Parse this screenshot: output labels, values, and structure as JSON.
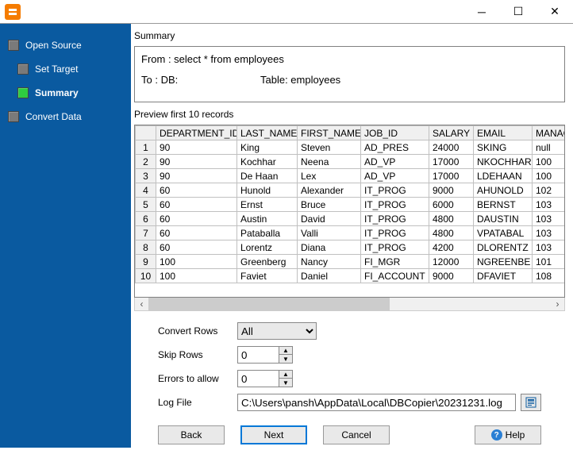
{
  "nav": {
    "items": [
      {
        "label": "Open Source"
      },
      {
        "label": "Set Target"
      },
      {
        "label": "Summary"
      },
      {
        "label": "Convert Data"
      }
    ]
  },
  "summary": {
    "heading": "Summary",
    "from_line": "From : select * from employees",
    "to_db_label": "To : DB:",
    "to_table_label": "Table: employees"
  },
  "preview": {
    "heading": "Preview first 10 records",
    "columns": [
      "DEPARTMENT_ID",
      "LAST_NAME",
      "FIRST_NAME",
      "JOB_ID",
      "SALARY",
      "EMAIL",
      "MANAG"
    ],
    "rows": [
      {
        "n": "1",
        "dept": "90",
        "last": "King",
        "first": "Steven",
        "job": "AD_PRES",
        "sal": "24000",
        "email": "SKING",
        "mgr": "null"
      },
      {
        "n": "2",
        "dept": "90",
        "last": "Kochhar",
        "first": "Neena",
        "job": "AD_VP",
        "sal": "17000",
        "email": "NKOCHHAR",
        "mgr": "100"
      },
      {
        "n": "3",
        "dept": "90",
        "last": "De Haan",
        "first": "Lex",
        "job": "AD_VP",
        "sal": "17000",
        "email": "LDEHAAN",
        "mgr": "100"
      },
      {
        "n": "4",
        "dept": "60",
        "last": "Hunold",
        "first": "Alexander",
        "job": "IT_PROG",
        "sal": "9000",
        "email": "AHUNOLD",
        "mgr": "102"
      },
      {
        "n": "5",
        "dept": "60",
        "last": "Ernst",
        "first": "Bruce",
        "job": "IT_PROG",
        "sal": "6000",
        "email": "BERNST",
        "mgr": "103"
      },
      {
        "n": "6",
        "dept": "60",
        "last": "Austin",
        "first": "David",
        "job": "IT_PROG",
        "sal": "4800",
        "email": "DAUSTIN",
        "mgr": "103"
      },
      {
        "n": "7",
        "dept": "60",
        "last": "Pataballa",
        "first": "Valli",
        "job": "IT_PROG",
        "sal": "4800",
        "email": "VPATABAL",
        "mgr": "103"
      },
      {
        "n": "8",
        "dept": "60",
        "last": "Lorentz",
        "first": "Diana",
        "job": "IT_PROG",
        "sal": "4200",
        "email": "DLORENTZ",
        "mgr": "103"
      },
      {
        "n": "9",
        "dept": "100",
        "last": "Greenberg",
        "first": "Nancy",
        "job": "FI_MGR",
        "sal": "12000",
        "email": "NGREENBE",
        "mgr": "101"
      },
      {
        "n": "10",
        "dept": "100",
        "last": "Faviet",
        "first": "Daniel",
        "job": "FI_ACCOUNT",
        "sal": "9000",
        "email": "DFAVIET",
        "mgr": "108"
      }
    ]
  },
  "form": {
    "convert_rows_label": "Convert Rows",
    "convert_rows_value": "All",
    "skip_rows_label": "Skip Rows",
    "skip_rows_value": "0",
    "errors_label": "Errors to allow",
    "errors_value": "0",
    "logfile_label": "Log File",
    "logfile_value": "C:\\Users\\pansh\\AppData\\Local\\DBCopier\\20231231.log"
  },
  "buttons": {
    "back": "Back",
    "next": "Next",
    "cancel": "Cancel",
    "help": "Help"
  }
}
